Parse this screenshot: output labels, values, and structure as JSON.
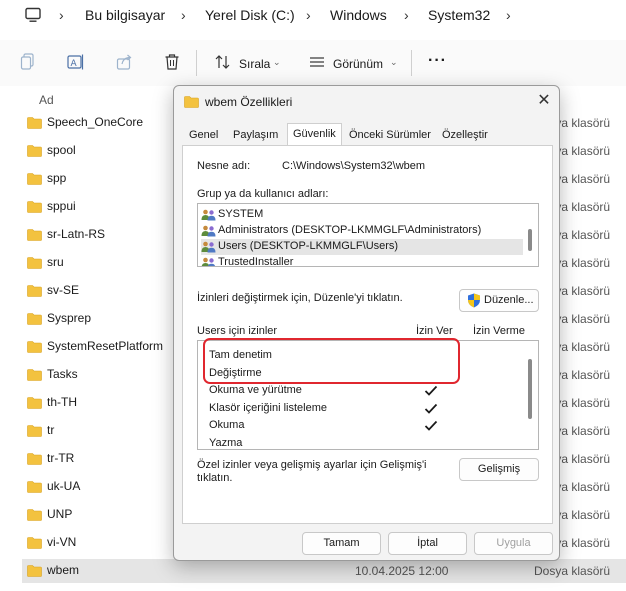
{
  "breadcrumb": [
    "Bu bilgisayar",
    "Yerel Disk (C:)",
    "Windows",
    "System32"
  ],
  "toolbar": {
    "sort_label": "Sırala",
    "view_label": "Görünüm",
    "more_label": "···"
  },
  "file_list": {
    "column_name": "Ad",
    "rows": [
      {
        "name": "Speech_OneCore",
        "type": "Dosya klasörü"
      },
      {
        "name": "spool",
        "type": "Dosya klasörü"
      },
      {
        "name": "spp",
        "type": "Dosya klasörü"
      },
      {
        "name": "sppui",
        "type": "Dosya klasörü"
      },
      {
        "name": "sr-Latn-RS",
        "type": "Dosya klasörü"
      },
      {
        "name": "sru",
        "type": "Dosya klasörü"
      },
      {
        "name": "sv-SE",
        "type": "Dosya klasörü"
      },
      {
        "name": "Sysprep",
        "type": "Dosya klasörü"
      },
      {
        "name": "SystemResetPlatform",
        "type": "Dosya klasörü"
      },
      {
        "name": "Tasks",
        "type": "Dosya klasörü"
      },
      {
        "name": "th-TH",
        "type": "Dosya klasörü"
      },
      {
        "name": "tr",
        "type": "Dosya klasörü"
      },
      {
        "name": "tr-TR",
        "type": "Dosya klasörü"
      },
      {
        "name": "uk-UA",
        "type": "Dosya klasörü"
      },
      {
        "name": "UNP",
        "type": "Dosya klasörü"
      },
      {
        "name": "vi-VN",
        "type": "Dosya klasörü"
      },
      {
        "name": "wbem",
        "date": "10.04.2025 12:00",
        "type": "Dosya klasörü"
      }
    ]
  },
  "dialog": {
    "title": "wbem Özellikleri",
    "tabs": [
      "Genel",
      "Paylaşım",
      "Güvenlik",
      "Önceki Sürümler",
      "Özelleştir"
    ],
    "object_name_label": "Nesne adı:",
    "object_name_value": "C:\\Windows\\System32\\wbem",
    "groups_label": "Grup ya da kullanıcı adları:",
    "users": [
      "SYSTEM",
      "Administrators (DESKTOP-LKMMGLF\\Administrators)",
      "Users (DESKTOP-LKMMGLF\\Users)",
      "TrustedInstaller"
    ],
    "edit_hint": "İzinleri değiştirmek için, Düzenle'yi tıklatın.",
    "edit_button": "Düzenle...",
    "permissions_label": "Users için izinler",
    "allow_header": "İzin Ver",
    "deny_header": "İzin Verme",
    "permissions": [
      {
        "name": "Tam denetim",
        "allow": false
      },
      {
        "name": "Değiştirme",
        "allow": false
      },
      {
        "name": "Okuma ve yürütme",
        "allow": true
      },
      {
        "name": "Klasör içeriğini listeleme",
        "allow": true
      },
      {
        "name": "Okuma",
        "allow": true
      },
      {
        "name": "Yazma",
        "allow": false
      }
    ],
    "advanced_hint_1": "Özel izinler veya gelişmiş ayarlar için Gelişmiş'i",
    "advanced_hint_2": "tıklatın.",
    "advanced_button": "Gelişmiş",
    "ok_button": "Tamam",
    "cancel_button": "İptal",
    "apply_button": "Uygula"
  },
  "colors": {
    "highlight": "#e0272f",
    "folder": "#f3c23f",
    "selection": "#e5e5e5"
  }
}
